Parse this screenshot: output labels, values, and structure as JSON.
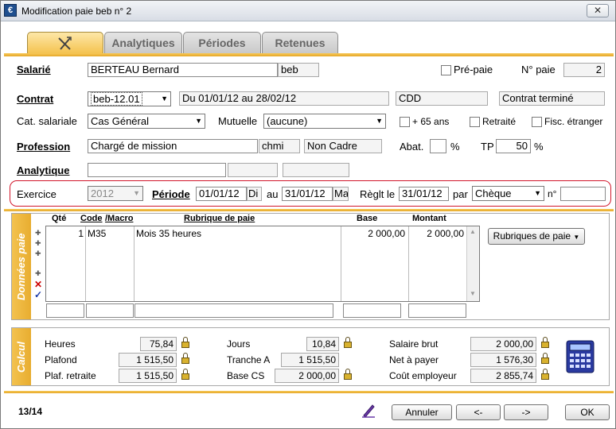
{
  "window": {
    "title": "Modification paie beb n° 2",
    "close": "✕"
  },
  "tabs": [
    {
      "label": "",
      "icon": "tools-icon"
    },
    {
      "label": "Analytiques"
    },
    {
      "label": "Périodes"
    },
    {
      "label": "Retenues"
    }
  ],
  "salarie": {
    "label": "Salarié",
    "name": "BERTEAU Bernard",
    "code": "beb",
    "prepaie_label": "Pré-paie",
    "npaie_label": "N° paie",
    "npaie": "2"
  },
  "contrat": {
    "label": "Contrat",
    "value": "beb-12.01",
    "dates": "Du 01/01/12 au 28/02/12",
    "type": "CDD",
    "status": "Contrat terminé"
  },
  "cat": {
    "label": "Cat. salariale",
    "value": "Cas Général",
    "mutuelle_label": "Mutuelle",
    "mutuelle": "(aucune)",
    "plus65": "+ 65 ans",
    "retraite": "Retraité",
    "fisc": "Fisc. étranger"
  },
  "profession": {
    "label": "Profession",
    "value": "Chargé de mission",
    "code": "chmi",
    "statut": "Non Cadre",
    "abat_label": "Abat.",
    "abat": "",
    "pct": "%",
    "tp_label": "TP",
    "tp": "50"
  },
  "analytique": {
    "label": "Analytique"
  },
  "exercice": {
    "label": "Exercice",
    "value": "2012",
    "periode_label": "Période",
    "from": "01/01/12",
    "from_day": "Di",
    "au": "au",
    "to": "31/01/12",
    "to_day": "Ma",
    "reglt_label": "Règlt le",
    "reglt": "31/01/12",
    "par": "par",
    "mode": "Chèque",
    "no_label": "n°",
    "no": ""
  },
  "donnees": {
    "side": "Données paie",
    "headers": {
      "qte": "Qté",
      "code": "Code",
      "macro": "/Macro",
      "rubrique": "Rubrique de paie",
      "base": "Base",
      "montant": "Montant"
    },
    "rows": [
      {
        "qte": "1",
        "code": "M35",
        "rubrique": "Mois 35 heures",
        "base": "2 000,00",
        "montant": "2 000,00"
      }
    ],
    "rubriques_button": "Rubriques de paie"
  },
  "calcul": {
    "side": "Calcul",
    "heures_label": "Heures",
    "heures": "75,84",
    "plafond_label": "Plafond",
    "plafond": "1 515,50",
    "plafret_label": "Plaf. retraite",
    "plafret": "1 515,50",
    "jours_label": "Jours",
    "jours": "10,84",
    "trancheA_label": "Tranche A",
    "trancheA": "1 515,50",
    "basecs_label": "Base CS",
    "basecs": "2 000,00",
    "brut_label": "Salaire brut",
    "brut": "2 000,00",
    "net_label": "Net à payer",
    "net": "1 576,30",
    "cout_label": "Coût employeur",
    "cout": "2 855,74"
  },
  "footer": {
    "counter": "13/14",
    "annuler": "Annuler",
    "prev": "<-",
    "next": "->",
    "ok": "OK"
  }
}
